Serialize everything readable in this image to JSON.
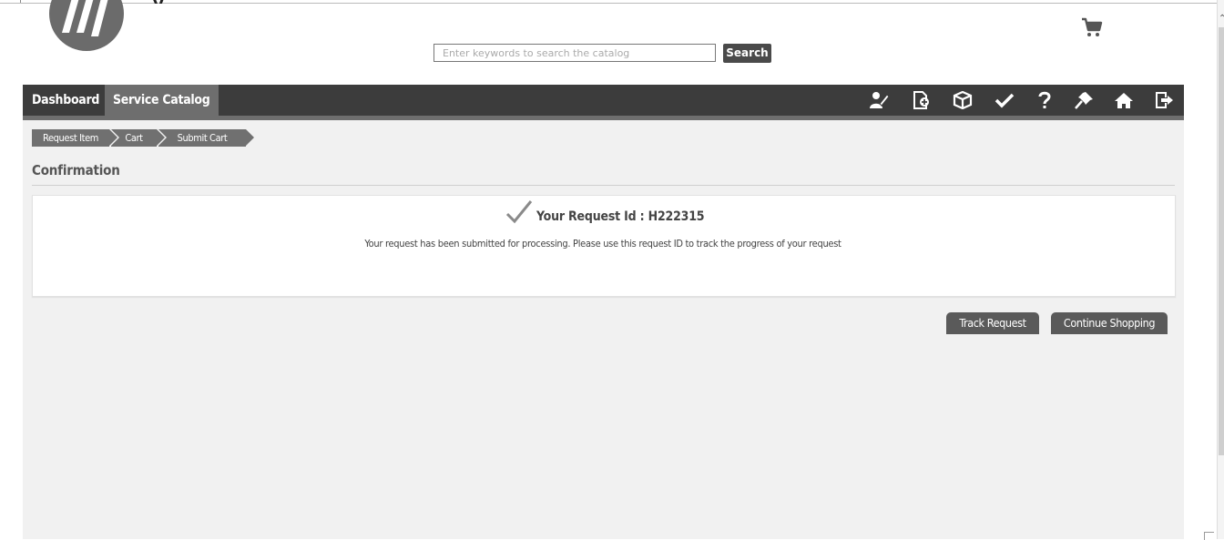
{
  "header": {
    "search_placeholder": "Enter keywords to search the catalog",
    "search_button": "Search"
  },
  "nav": {
    "items": [
      {
        "label": "Dashboard"
      },
      {
        "label": "Service Catalog"
      }
    ],
    "icons": [
      "request-edit-icon",
      "add-document-icon",
      "package-icon",
      "approve-check-icon",
      "help-icon",
      "pin-icon",
      "home-icon",
      "logout-icon"
    ]
  },
  "breadcrumb": [
    "Request Item",
    "Cart",
    "Submit Cart"
  ],
  "page": {
    "title": "Confirmation"
  },
  "confirmation": {
    "request_id_label": "Your Request Id : H222315",
    "message": "Your request has been submitted for processing. Please use this request ID to track the progress of your request"
  },
  "actions": {
    "track_request": "Track Request",
    "continue_shopping": "Continue Shopping"
  },
  "colors": {
    "navbar": "#3c3c3c",
    "nav_active": "#6e6e6e",
    "content_bg": "#f1f1f1",
    "button": "#5a5a5a"
  }
}
